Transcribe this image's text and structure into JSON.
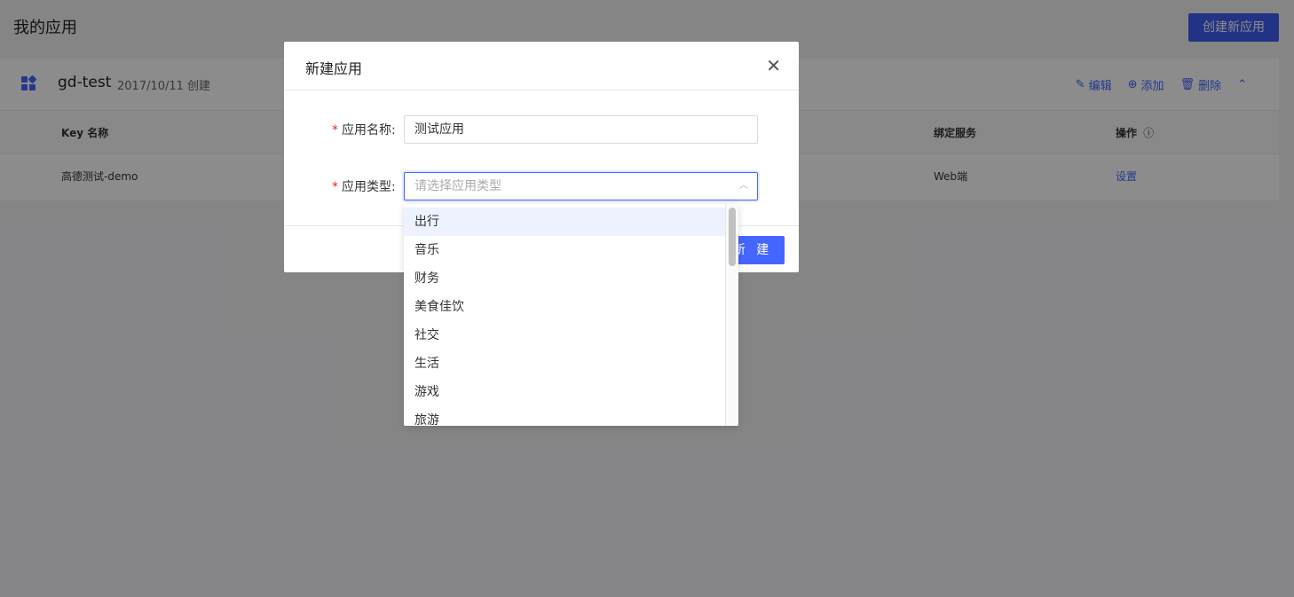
{
  "page": {
    "title": "我的应用",
    "create_label": "创建新应用"
  },
  "app": {
    "name": "gd-test",
    "created": "2017/10/11 创建",
    "actions": {
      "edit": "编辑",
      "add": "添加",
      "delete": "删除"
    }
  },
  "table": {
    "headers": {
      "key_name": "Key 名称",
      "binding": "绑定服务",
      "ops": "操作"
    },
    "row": {
      "key_name": "高德测试-demo",
      "binding": "Web端",
      "op": "设置"
    }
  },
  "modal": {
    "title": "新建应用",
    "name_label": "应用名称:",
    "name_value": "测试应用",
    "type_label": "应用类型:",
    "type_placeholder": "请选择应用类型",
    "submit": "新 建"
  },
  "dropdown": {
    "options": [
      "出行",
      "音乐",
      "财务",
      "美食佳饮",
      "社交",
      "生活",
      "游戏",
      "旅游"
    ],
    "active_index": 0
  },
  "colors": {
    "primary": "#4466ff",
    "required": "#f5222d",
    "page_button": "#3f5cf0"
  }
}
